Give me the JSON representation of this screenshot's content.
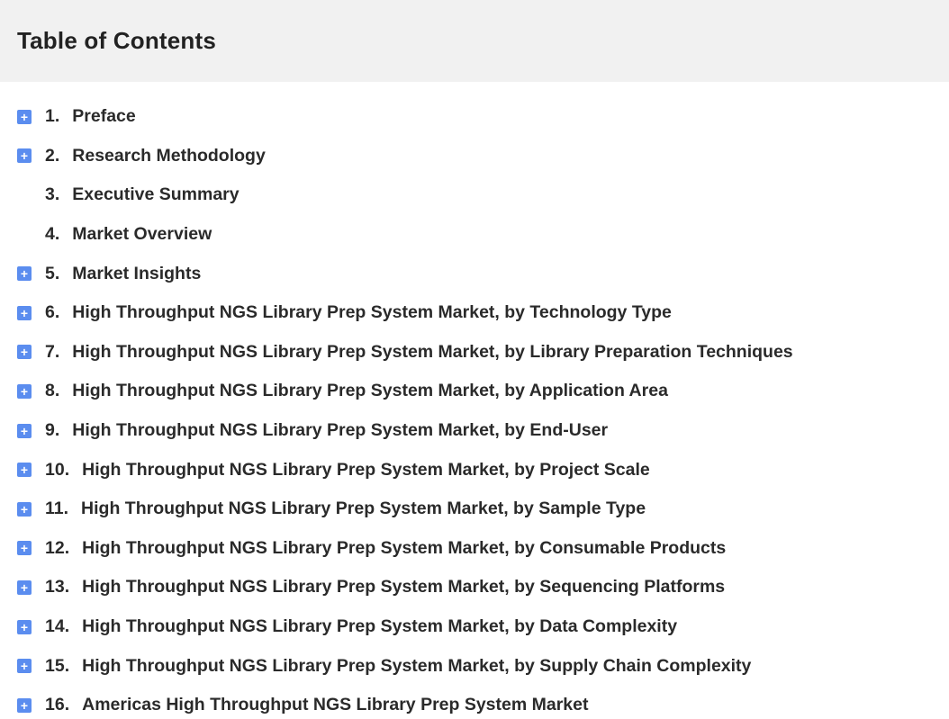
{
  "header": {
    "title": "Table of Contents"
  },
  "toc": {
    "items": [
      {
        "number": "1.",
        "label": "Preface",
        "expandable": true
      },
      {
        "number": "2.",
        "label": "Research Methodology",
        "expandable": true
      },
      {
        "number": "3.",
        "label": "Executive Summary",
        "expandable": false
      },
      {
        "number": "4.",
        "label": "Market Overview",
        "expandable": false
      },
      {
        "number": "5.",
        "label": "Market Insights",
        "expandable": true
      },
      {
        "number": "6.",
        "label": "High Throughput NGS Library Prep System Market, by Technology Type",
        "expandable": true
      },
      {
        "number": "7.",
        "label": "High Throughput NGS Library Prep System Market, by Library Preparation Techniques",
        "expandable": true
      },
      {
        "number": "8.",
        "label": "High Throughput NGS Library Prep System Market, by Application Area",
        "expandable": true
      },
      {
        "number": "9.",
        "label": "High Throughput NGS Library Prep System Market, by End-User",
        "expandable": true
      },
      {
        "number": "10.",
        "label": "High Throughput NGS Library Prep System Market, by Project Scale",
        "expandable": true
      },
      {
        "number": "11.",
        "label": "High Throughput NGS Library Prep System Market, by Sample Type",
        "expandable": true
      },
      {
        "number": "12.",
        "label": "High Throughput NGS Library Prep System Market, by Consumable Products",
        "expandable": true
      },
      {
        "number": "13.",
        "label": "High Throughput NGS Library Prep System Market, by Sequencing Platforms",
        "expandable": true
      },
      {
        "number": "14.",
        "label": "High Throughput NGS Library Prep System Market, by Data Complexity",
        "expandable": true
      },
      {
        "number": "15.",
        "label": "High Throughput NGS Library Prep System Market, by Supply Chain Complexity",
        "expandable": true
      },
      {
        "number": "16.",
        "label": "Americas High Throughput NGS Library Prep System Market",
        "expandable": true
      }
    ],
    "expand_glyph": "+"
  },
  "colors": {
    "header_bg": "#f1f1f1",
    "icon_bg": "#5b8def",
    "text": "#2a2a2a"
  },
  "icons": {
    "expand": "plus-square-icon"
  }
}
